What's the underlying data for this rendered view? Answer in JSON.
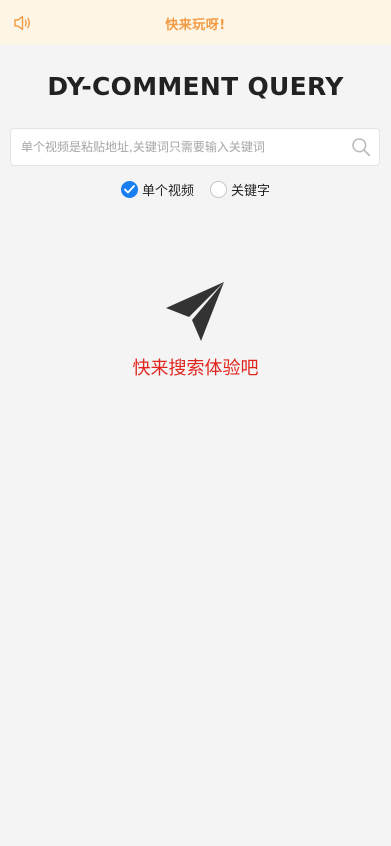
{
  "notice": {
    "icon": "speaker-icon",
    "text": "快来玩呀!",
    "color": "#f39b45",
    "background": "#fdf6e6"
  },
  "page": {
    "title": "DY-COMMENT QUERY"
  },
  "search": {
    "placeholder": "单个视频是粘贴地址,关键词只需要输入关键词",
    "value": "",
    "icon": "search-icon"
  },
  "mode": {
    "options": [
      {
        "label": "单个视频",
        "checked": true
      },
      {
        "label": "关键字",
        "checked": false
      }
    ],
    "accent": "#1a7ff0"
  },
  "empty_state": {
    "icon": "send-icon",
    "text": "快来搜索体验吧",
    "color": "#e0251f"
  }
}
